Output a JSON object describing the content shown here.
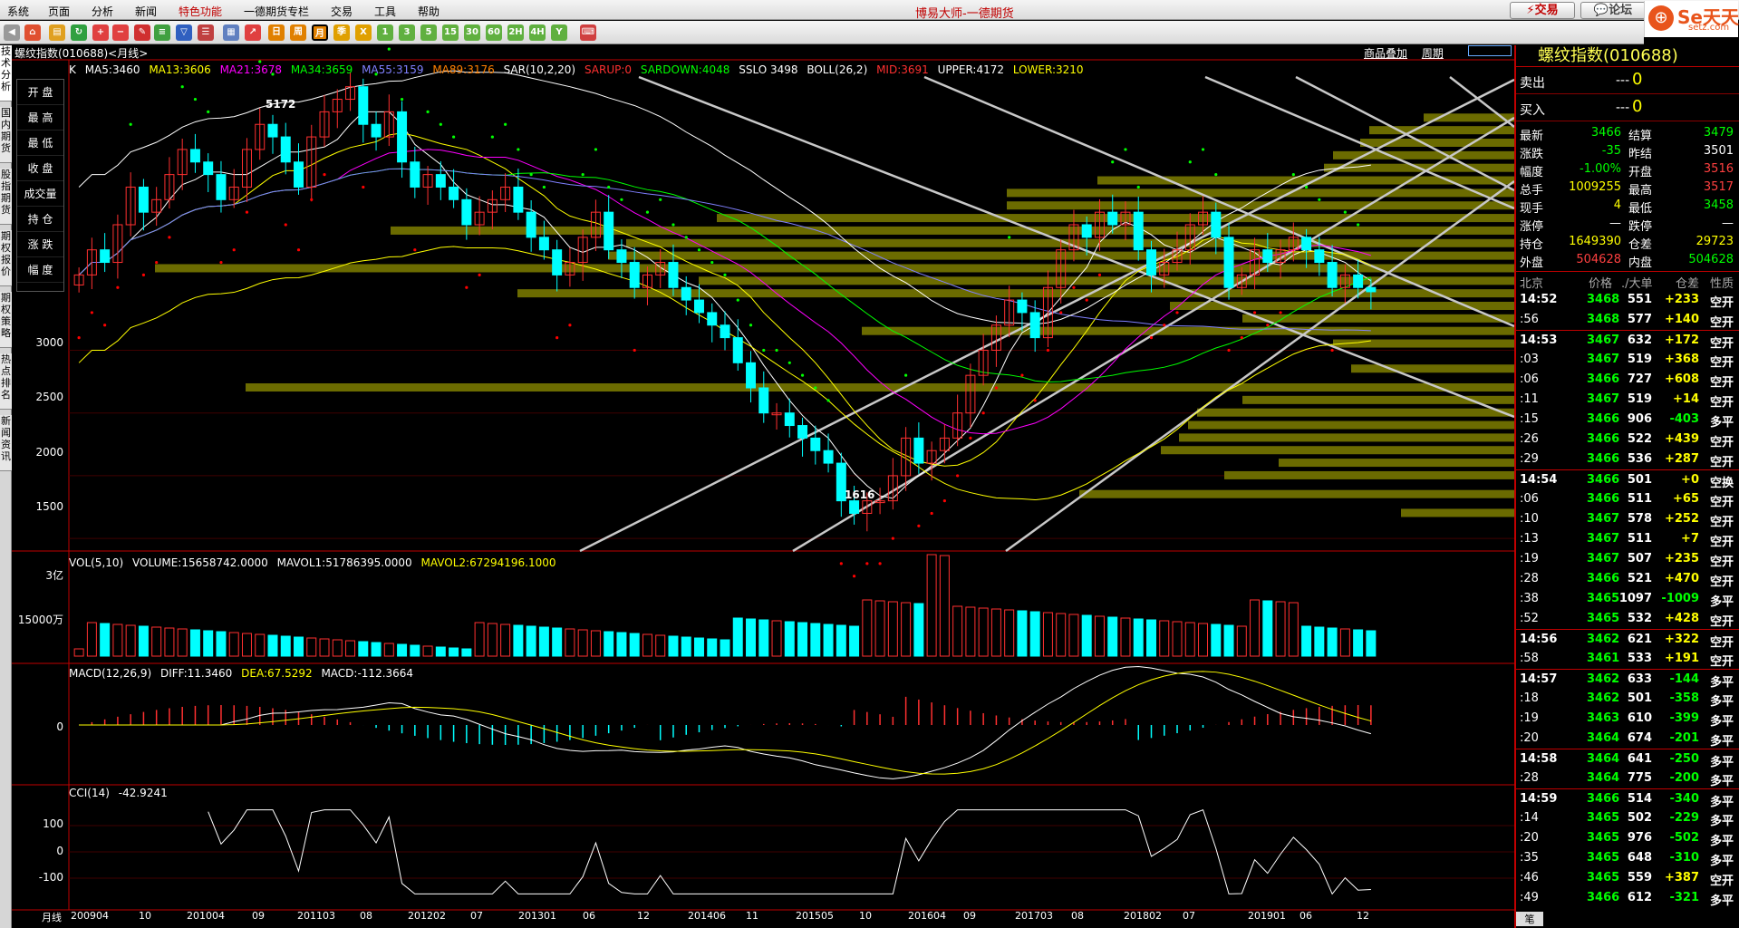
{
  "menu": [
    "系统",
    "页面",
    "分析",
    "新闻",
    "特色功能",
    "一德期货专栏",
    "交易",
    "工具",
    "帮助"
  ],
  "app_title": "博易大师-一德期货",
  "buttons": {
    "trade": "交易",
    "forum": "论坛"
  },
  "logo": {
    "main": "Se天天",
    "sub": "setz.com"
  },
  "toolbar_icons": [
    "back-icon",
    "home-icon",
    "book-icon",
    "refresh-icon",
    "zoom-in-icon",
    "zoom-out-icon",
    "pen-icon",
    "lines-icon",
    "filter-icon",
    "list-icon",
    "table-icon",
    "chart-icon",
    "calendar-day-icon",
    "calendar-week-icon",
    "calendar-month-icon",
    "year-icon",
    "season-icon",
    "x-icon",
    "min1-icon",
    "min3-icon",
    "min5-icon",
    "min15-icon",
    "min30-icon",
    "min60-icon",
    "hour2-icon",
    "hour4-icon",
    "year-y-icon",
    "keyboard-icon"
  ],
  "toolbar_labels": {
    "d": "日",
    "w": "周",
    "m": "月",
    "s": "季",
    "x": "X",
    "m1": "1",
    "m3": "3",
    "m5": "5",
    "m15": "15",
    "m30": "30",
    "m60": "60",
    "h2": "2H",
    "h4": "4H",
    "y": "Y"
  },
  "left_tabs": [
    "技术分析",
    "国内期货",
    "股指期货",
    "期权报价",
    "期权策略",
    "热点排名",
    "新闻资讯"
  ],
  "symbol_title": "螺纹指数(010688)<月线>",
  "right_links": [
    "商品叠加",
    "周期"
  ],
  "ma_line": {
    "k": "K",
    "ma5": "MA5:3460",
    "ma13": "MA13:3606",
    "ma21": "MA21:3678",
    "ma34": "MA34:3659",
    "ma55": "MA55:3159",
    "ma89": "MA89:3176",
    "sar": "SAR(10,2,20)",
    "sarup": "SARUP:0",
    "sardown": "SARDOWN:4048",
    "sslo": "SSLO 3498",
    "boll": "BOLL(26,2)",
    "mid": "MID:3691",
    "upper": "UPPER:4172",
    "lower": "LOWER:3210"
  },
  "ohlc_box": [
    "开 盘",
    "最 高",
    "最 低",
    "收 盘",
    "成交量",
    "持 仓",
    "涨 跌",
    "幅 度"
  ],
  "price_labels": {
    "high": "5172",
    "low": "1616"
  },
  "y_axis_main": [
    "3000",
    "2500",
    "2000",
    "1500"
  ],
  "vol_line": {
    "title": "VOL(5,10)",
    "volume": "VOLUME:15658742.0000",
    "mavol1": "MAVOL1:51786395.0000",
    "mavol2": "MAVOL2:67294196.1000"
  },
  "y_axis_vol": [
    "3亿",
    "15000万"
  ],
  "macd_line": {
    "title": "MACD(12,26,9)",
    "diff": "DIFF:11.3460",
    "dea": "DEA:67.5292",
    "macd": "MACD:-112.3664"
  },
  "y_axis_macd": [
    "0"
  ],
  "cci_line": {
    "title": "CCI(14)",
    "value": "-42.9241"
  },
  "y_axis_cci": [
    "100",
    "0",
    "-100"
  ],
  "x_axis": {
    "label": "月线",
    "ticks": [
      "200904",
      "10",
      "201004",
      "09",
      "201103",
      "08",
      "201202",
      "07",
      "201301",
      "06",
      "12",
      "201406",
      "11",
      "201505",
      "10",
      "201604",
      "09",
      "201703",
      "08",
      "201802",
      "07",
      "201901",
      "06",
      "12"
    ]
  },
  "right_panel": {
    "title": "螺纹指数(010688)",
    "sell": {
      "label": "卖出",
      "price": "---",
      "vol": "0"
    },
    "buy": {
      "label": "买入",
      "price": "---",
      "vol": "0"
    },
    "quotes": [
      {
        "l1": "最新",
        "v1": "3466",
        "c1": "#00ff00",
        "l2": "结算",
        "v2": "3479",
        "c2": "#00ff00"
      },
      {
        "l1": "涨跌",
        "v1": "-35",
        "c1": "#00ff00",
        "l2": "昨结",
        "v2": "3501",
        "c2": "#ffffff"
      },
      {
        "l1": "幅度",
        "v1": "-1.00%",
        "c1": "#00ff00",
        "l2": "开盘",
        "v2": "3516",
        "c2": "#ff4040"
      },
      {
        "l1": "总手",
        "v1": "1009255",
        "c1": "#ffff00",
        "l2": "最高",
        "v2": "3517",
        "c2": "#ff4040"
      },
      {
        "l1": "现手",
        "v1": "4",
        "c1": "#ffff00",
        "l2": "最低",
        "v2": "3458",
        "c2": "#00ff00"
      },
      {
        "l1": "涨停",
        "v1": "—",
        "c1": "#ffffff",
        "l2": "跌停",
        "v2": "—",
        "c2": "#ffffff"
      },
      {
        "l1": "持仓",
        "v1": "1649390",
        "c1": "#ffff00",
        "l2": "仓差",
        "v2": "29723",
        "c2": "#ffff00"
      },
      {
        "l1": "外盘",
        "v1": "504628",
        "c1": "#ff4040",
        "l2": "内盘",
        "v2": "504628",
        "c2": "#00ff00"
      }
    ],
    "tick_header": [
      "北京",
      "价格",
      "./大单",
      "仓差",
      "性质"
    ],
    "ticks": [
      [
        "14:52",
        "3468",
        "551",
        "+233",
        "空开"
      ],
      [
        ":56",
        "3468",
        "577",
        "+140",
        "空开"
      ],
      [
        "14:53",
        "3467",
        "632",
        "+172",
        "空开"
      ],
      [
        ":03",
        "3467",
        "519",
        "+368",
        "空开"
      ],
      [
        ":06",
        "3466",
        "727",
        "+608",
        "空开"
      ],
      [
        ":11",
        "3467",
        "519",
        "+14",
        "空开"
      ],
      [
        ":15",
        "3466",
        "906",
        "-403",
        "多平"
      ],
      [
        ":26",
        "3466",
        "522",
        "+439",
        "空开"
      ],
      [
        ":29",
        "3466",
        "536",
        "+287",
        "空开"
      ],
      [
        "14:54",
        "3466",
        "501",
        "+0",
        "空换"
      ],
      [
        ":06",
        "3466",
        "511",
        "+65",
        "空开"
      ],
      [
        ":10",
        "3467",
        "578",
        "+252",
        "空开"
      ],
      [
        ":13",
        "3467",
        "511",
        "+7",
        "空开"
      ],
      [
        ":19",
        "3467",
        "507",
        "+235",
        "空开"
      ],
      [
        ":28",
        "3466",
        "521",
        "+470",
        "空开"
      ],
      [
        ":38",
        "3465",
        "1097",
        "-1009",
        "多平"
      ],
      [
        ":52",
        "3465",
        "532",
        "+428",
        "空开"
      ],
      [
        "14:56",
        "3462",
        "621",
        "+322",
        "空开"
      ],
      [
        ":58",
        "3461",
        "533",
        "+191",
        "空开"
      ],
      [
        "14:57",
        "3462",
        "633",
        "-144",
        "多平"
      ],
      [
        ":18",
        "3462",
        "501",
        "-358",
        "多平"
      ],
      [
        ":19",
        "3463",
        "610",
        "-399",
        "多平"
      ],
      [
        ":20",
        "3464",
        "674",
        "-201",
        "多平"
      ],
      [
        "14:58",
        "3464",
        "641",
        "-250",
        "多平"
      ],
      [
        ":28",
        "3464",
        "775",
        "-200",
        "多平"
      ],
      [
        "14:59",
        "3466",
        "514",
        "-340",
        "多平"
      ],
      [
        ":14",
        "3465",
        "502",
        "-229",
        "多平"
      ],
      [
        ":20",
        "3465",
        "976",
        "-502",
        "多平"
      ],
      [
        ":35",
        "3465",
        "648",
        "-310",
        "多平"
      ],
      [
        ":46",
        "3465",
        "559",
        "+387",
        "空开"
      ],
      [
        ":49",
        "3466",
        "612",
        "-321",
        "多平"
      ]
    ],
    "bottom_tab": "笔"
  },
  "chart_data": {
    "type": "candlestick",
    "title": "螺纹指数(010688)<月线>",
    "period": "monthly",
    "x_range": [
      "200904",
      "201912"
    ],
    "y_range_main": [
      1400,
      5300
    ],
    "annotated_high": 5172,
    "annotated_low": 1616,
    "closes": [
      3600,
      3800,
      3700,
      4000,
      4300,
      4100,
      4200,
      4400,
      4600,
      4500,
      4400,
      4200,
      4300,
      4600,
      4800,
      4700,
      4500,
      4300,
      4700,
      4900,
      5000,
      5100,
      4800,
      4700,
      4900,
      4500,
      4300,
      4400,
      4300,
      4200,
      4000,
      4100,
      4200,
      4300,
      4100,
      3900,
      3800,
      3600,
      3700,
      3900,
      4100,
      3800,
      3700,
      3500,
      3600,
      3700,
      3500,
      3400,
      3300,
      3200,
      3100,
      2900,
      2700,
      2500,
      2500,
      2400,
      2300,
      2200,
      2100,
      1800,
      1700,
      1800,
      1800,
      2000,
      2300,
      2100,
      2200,
      2300,
      2500,
      2800,
      3000,
      3200,
      3400,
      3300,
      3100,
      3500,
      3800,
      4000,
      3900,
      4100,
      4000,
      4100,
      3800,
      3600,
      3700,
      3800,
      4000,
      4100,
      3900,
      3500,
      3600,
      3800,
      3700,
      3800,
      3900,
      3800,
      3700,
      3500,
      3600,
      3500,
      3466
    ],
    "series": [
      {
        "name": "MA5",
        "value": 3460
      },
      {
        "name": "MA13",
        "value": 3606
      },
      {
        "name": "MA21",
        "value": 3678
      },
      {
        "name": "MA34",
        "value": 3659
      },
      {
        "name": "MA55",
        "value": 3159
      },
      {
        "name": "MA89",
        "value": 3176
      },
      {
        "name": "MID",
        "value": 3691
      },
      {
        "name": "UPPER",
        "value": 4172
      },
      {
        "name": "LOWER",
        "value": 3210
      }
    ],
    "volume": {
      "VOLUME": 15658742.0,
      "MAVOL1": 51786395.0,
      "MAVOL2": 67294196.1
    },
    "macd": {
      "DIFF": 11.346,
      "DEA": 67.5292,
      "MACD": -112.3664
    },
    "cci": {
      "CCI14": -42.9241,
      "ylim": [
        -150,
        150
      ]
    },
    "colors": {
      "up": "#ff3030",
      "down": "#00ffff",
      "ma5": "#ffffff",
      "ma13": "#ffff00",
      "ma21": "#ff00ff",
      "ma34": "#00ff00",
      "ma55": "#8080ff",
      "ma89": "#ff8000",
      "sar": "#ff0000",
      "volprofile": "#6b6b00"
    }
  }
}
